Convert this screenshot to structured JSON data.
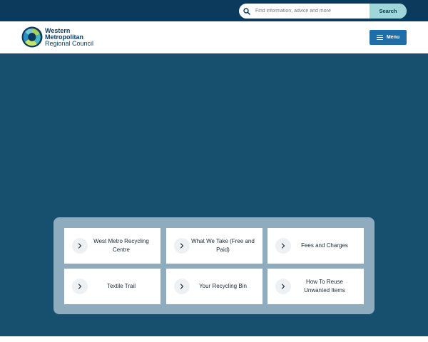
{
  "search": {
    "placeholder": "Find information, advice and more",
    "button_label": "Search",
    "icon": "search-icon"
  },
  "header": {
    "logo": {
      "line1": "Western",
      "line2": "Metropolitan",
      "line3": "Regional Council"
    },
    "menu_label": "Menu",
    "menu_icon": "hamburger-icon"
  },
  "colors": {
    "topbar": "#0b3a5d",
    "hero": "#17506f",
    "panel": "#8facbf",
    "search_button": "#9fd6d8",
    "menu_button": "#1f6ea8"
  },
  "quick_links": [
    {
      "label": "West Metro Recycling Centre",
      "icon": "chevron-right-icon"
    },
    {
      "label": "What We Take (Free and Paid)",
      "icon": "chevron-right-icon"
    },
    {
      "label": "Fees and Charges",
      "icon": "chevron-right-icon"
    },
    {
      "label": "Textile Trail",
      "icon": "chevron-right-icon"
    },
    {
      "label": "Your Recycling Bin",
      "icon": "chevron-right-icon"
    },
    {
      "label": "How To Reuse Unwanted Items",
      "icon": "chevron-right-icon"
    }
  ]
}
